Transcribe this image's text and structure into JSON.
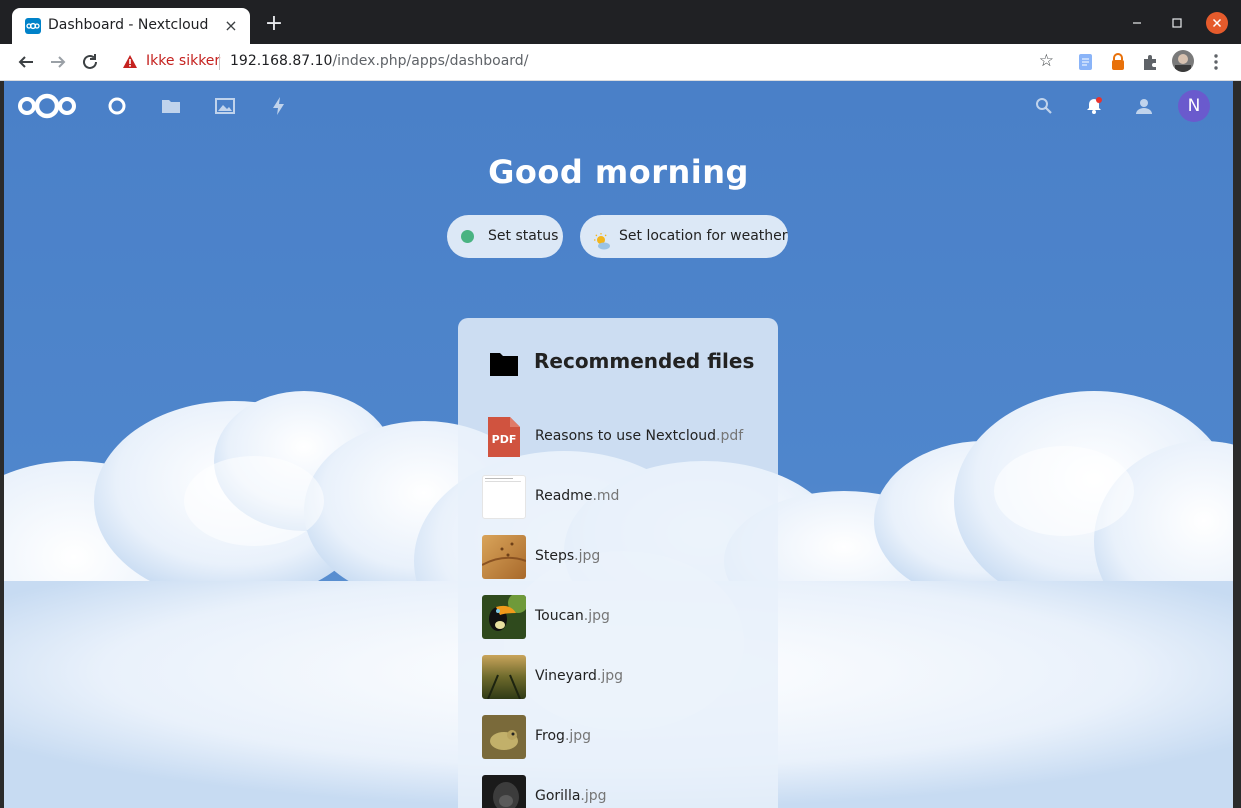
{
  "browser": {
    "tab_title": "Dashboard - Nextcloud",
    "tab_close": "×",
    "new_tab": "+",
    "security_label": "Ikke sikker",
    "url_host": "192.168.87.10",
    "url_path": "/index.php/apps/dashboard/",
    "back_icon": "arrow-left-icon",
    "forward_icon": "arrow-right-icon",
    "reload_icon": "reload-icon"
  },
  "app": {
    "header_icons": [
      "dashboard-icon",
      "files-icon",
      "photos-icon",
      "activity-icon"
    ],
    "right_icons": [
      "search-icon",
      "notifications-icon",
      "contacts-icon"
    ],
    "avatar_initial": "N",
    "greeting": "Good morning",
    "status_button": "Set status",
    "weather_button": "Set location for weather",
    "status_color": "#49b382",
    "accent": "#4a80c8"
  },
  "recommended": {
    "title": "Recommended files",
    "files": [
      {
        "name": "Reasons to use Nextcloud",
        "ext": ".pdf",
        "thumb": "pdf"
      },
      {
        "name": "Readme",
        "ext": ".md",
        "thumb": "doc"
      },
      {
        "name": "Steps",
        "ext": ".jpg",
        "thumb": "sand"
      },
      {
        "name": "Toucan",
        "ext": ".jpg",
        "thumb": "toucan"
      },
      {
        "name": "Vineyard",
        "ext": ".jpg",
        "thumb": "vineyard"
      },
      {
        "name": "Frog",
        "ext": ".jpg",
        "thumb": "frog"
      },
      {
        "name": "Gorilla",
        "ext": ".jpg",
        "thumb": "gorilla"
      }
    ]
  }
}
